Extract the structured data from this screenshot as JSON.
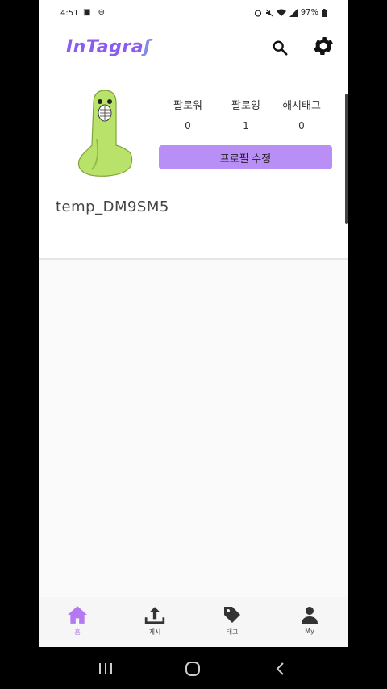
{
  "status": {
    "time": "4:51",
    "left_icons": "▣ ⊖",
    "battery": "97%"
  },
  "app": {
    "logo_text": "InTagra",
    "logo_tail": "ʃ"
  },
  "profile": {
    "stats": [
      {
        "label": "팔로워",
        "value": "0"
      },
      {
        "label": "팔로잉",
        "value": "1"
      },
      {
        "label": "해시태그",
        "value": "0"
      }
    ],
    "edit_button_label": "프로필 수정",
    "username": "temp_DM9SM5"
  },
  "bottom_nav": {
    "items": [
      {
        "label": "홈",
        "icon": "home-icon",
        "active": true
      },
      {
        "label": "게시",
        "icon": "upload-icon",
        "active": false
      },
      {
        "label": "태그",
        "icon": "tag-icon",
        "active": false
      },
      {
        "label": "My",
        "icon": "person-icon",
        "active": false
      }
    ]
  },
  "colors": {
    "accent": "#b98ef5",
    "active_nav": "#b478f0",
    "logo": "#8a5cf0"
  }
}
